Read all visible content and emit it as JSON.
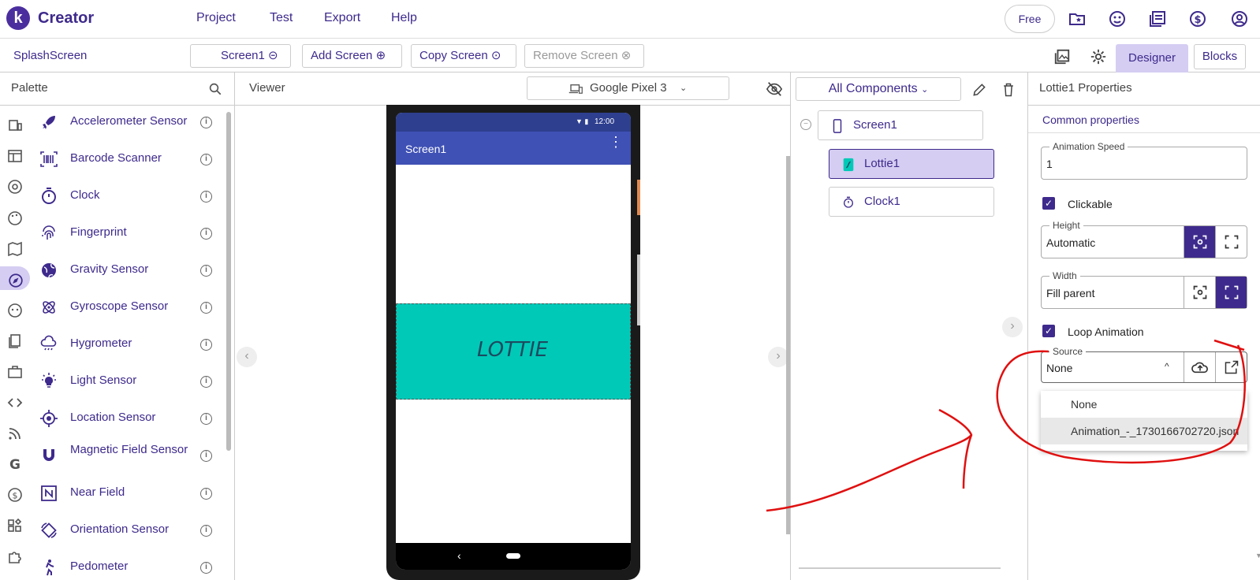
{
  "app": {
    "logo_letter": "k",
    "title": "Creator"
  },
  "menu": [
    "Project",
    "Test",
    "Export",
    "Help"
  ],
  "top_right": {
    "plan": "Free",
    "icons": [
      "folder-star-icon",
      "face-icon",
      "library-icon",
      "dollar-icon",
      "account-icon"
    ]
  },
  "toolbar": {
    "project_name": "SplashScreen",
    "screen_select": "Screen1",
    "add_screen": "Add Screen",
    "copy_screen": "Copy Screen",
    "remove_screen": "Remove Screen",
    "designer": "Designer",
    "blocks": "Blocks"
  },
  "palette": {
    "title": "Palette",
    "items": [
      {
        "label": "Accelerometer Sensor",
        "icon": "rocket-icon"
      },
      {
        "label": "Barcode Scanner",
        "icon": "barcode-icon"
      },
      {
        "label": "Clock",
        "icon": "timer-icon"
      },
      {
        "label": "Fingerprint",
        "icon": "fingerprint-icon"
      },
      {
        "label": "Gravity Sensor",
        "icon": "globe-icon"
      },
      {
        "label": "Gyroscope Sensor",
        "icon": "atom-icon"
      },
      {
        "label": "Hygrometer",
        "icon": "cloud-rain-icon"
      },
      {
        "label": "Light Sensor",
        "icon": "bulb-icon"
      },
      {
        "label": "Location Sensor",
        "icon": "target-icon"
      },
      {
        "label": "Magnetic Field Sensor",
        "icon": "magnet-icon"
      },
      {
        "label": "Near Field",
        "icon": "nfc-icon"
      },
      {
        "label": "Orientation Sensor",
        "icon": "rotate-icon"
      },
      {
        "label": "Pedometer",
        "icon": "walk-icon"
      }
    ]
  },
  "viewer": {
    "title": "Viewer",
    "device": "Google Pixel 3",
    "phone_time": "12:00",
    "screen_title": "Screen1",
    "lottie_text": "LOTTIE"
  },
  "components": {
    "filter": "All Components",
    "tree": [
      {
        "label": "Screen1",
        "icon": "phone-icon"
      },
      {
        "label": "Lottie1",
        "icon": "lottie-icon"
      },
      {
        "label": "Clock1",
        "icon": "timer-icon"
      }
    ]
  },
  "properties": {
    "title": "Lottie1 Properties",
    "section": "Common properties",
    "animation_speed_label": "Animation Speed",
    "animation_speed": "1",
    "clickable_label": "Clickable",
    "height_label": "Height",
    "height": "Automatic",
    "width_label": "Width",
    "width": "Fill parent",
    "loop_label": "Loop Animation",
    "source_label": "Source",
    "source": "None",
    "source_options": [
      "None",
      "Animation_-_1730166702720.json"
    ]
  },
  "colors": {
    "brand": "#3e2a8c",
    "accent_bg": "#d5cdf2",
    "annotation": "#e01010",
    "lottie_bg": "#00c9b7"
  }
}
